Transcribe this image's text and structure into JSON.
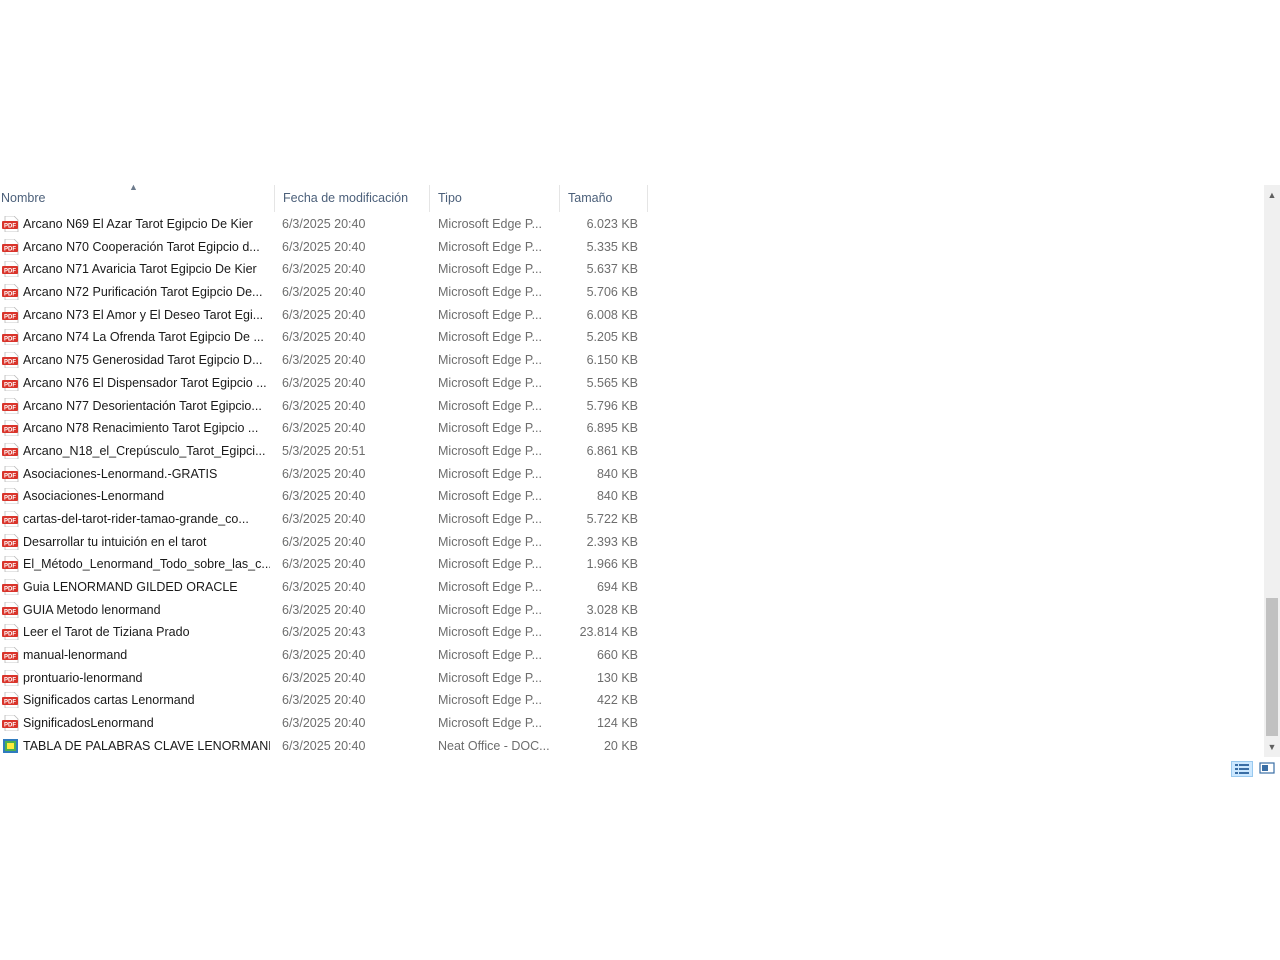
{
  "columns": {
    "name": "Nombre",
    "date": "Fecha de modificación",
    "type": "Tipo",
    "size": "Tamaño"
  },
  "sort_indicator": "^",
  "files": [
    {
      "icon": "pdf-icon",
      "name": "Arcano N69 El Azar Tarot Egipcio De Kier",
      "date": "6/3/2025 20:40",
      "type": "Microsoft Edge P...",
      "size": "6.023 KB"
    },
    {
      "icon": "pdf-icon",
      "name": "Arcano N70 Cooperación Tarot Egipcio d...",
      "date": "6/3/2025 20:40",
      "type": "Microsoft Edge P...",
      "size": "5.335 KB"
    },
    {
      "icon": "pdf-icon",
      "name": "Arcano N71 Avaricia Tarot Egipcio De Kier",
      "date": "6/3/2025 20:40",
      "type": "Microsoft Edge P...",
      "size": "5.637 KB"
    },
    {
      "icon": "pdf-icon",
      "name": "Arcano N72 Purificación Tarot Egipcio De...",
      "date": "6/3/2025 20:40",
      "type": "Microsoft Edge P...",
      "size": "5.706 KB"
    },
    {
      "icon": "pdf-icon",
      "name": "Arcano N73 El Amor y El Deseo Tarot Egi...",
      "date": "6/3/2025 20:40",
      "type": "Microsoft Edge P...",
      "size": "6.008 KB"
    },
    {
      "icon": "pdf-icon",
      "name": "Arcano N74 La Ofrenda Tarot Egipcio De ...",
      "date": "6/3/2025 20:40",
      "type": "Microsoft Edge P...",
      "size": "5.205 KB"
    },
    {
      "icon": "pdf-icon",
      "name": "Arcano N75 Generosidad Tarot Egipcio D...",
      "date": "6/3/2025 20:40",
      "type": "Microsoft Edge P...",
      "size": "6.150 KB"
    },
    {
      "icon": "pdf-icon",
      "name": "Arcano N76 El Dispensador Tarot Egipcio ...",
      "date": "6/3/2025 20:40",
      "type": "Microsoft Edge P...",
      "size": "5.565 KB"
    },
    {
      "icon": "pdf-icon",
      "name": "Arcano N77 Desorientación Tarot Egipcio...",
      "date": "6/3/2025 20:40",
      "type": "Microsoft Edge P...",
      "size": "5.796 KB"
    },
    {
      "icon": "pdf-icon",
      "name": "Arcano N78 Renacimiento Tarot Egipcio ...",
      "date": "6/3/2025 20:40",
      "type": "Microsoft Edge P...",
      "size": "6.895 KB"
    },
    {
      "icon": "pdf-icon",
      "name": "Arcano_N18_el_Crepúsculo_Tarot_Egipci...",
      "date": "5/3/2025 20:51",
      "type": "Microsoft Edge P...",
      "size": "6.861 KB"
    },
    {
      "icon": "pdf-icon",
      "name": "Asociaciones-Lenormand.-GRATIS",
      "date": "6/3/2025 20:40",
      "type": "Microsoft Edge P...",
      "size": "840 KB"
    },
    {
      "icon": "pdf-icon",
      "name": "Asociaciones-Lenormand",
      "date": "6/3/2025 20:40",
      "type": "Microsoft Edge P...",
      "size": "840 KB"
    },
    {
      "icon": "pdf-icon",
      "name": "cartas-del-tarot-rider-tamao-grande_co...",
      "date": "6/3/2025 20:40",
      "type": "Microsoft Edge P...",
      "size": "5.722 KB"
    },
    {
      "icon": "pdf-icon",
      "name": "Desarrollar tu intuición en el tarot",
      "date": "6/3/2025 20:40",
      "type": "Microsoft Edge P...",
      "size": "2.393 KB"
    },
    {
      "icon": "pdf-icon",
      "name": "El_Método_Lenormand_Todo_sobre_las_c...",
      "date": "6/3/2025 20:40",
      "type": "Microsoft Edge P...",
      "size": "1.966 KB"
    },
    {
      "icon": "pdf-icon",
      "name": "Guia LENORMAND GILDED ORACLE",
      "date": "6/3/2025 20:40",
      "type": "Microsoft Edge P...",
      "size": "694 KB"
    },
    {
      "icon": "pdf-icon",
      "name": "GUIA Metodo lenormand",
      "date": "6/3/2025 20:40",
      "type": "Microsoft Edge P...",
      "size": "3.028 KB"
    },
    {
      "icon": "pdf-icon",
      "name": "Leer el Tarot de Tiziana Prado",
      "date": "6/3/2025 20:43",
      "type": "Microsoft Edge P...",
      "size": "23.814 KB"
    },
    {
      "icon": "pdf-icon",
      "name": "manual-lenormand",
      "date": "6/3/2025 20:40",
      "type": "Microsoft Edge P...",
      "size": "660 KB"
    },
    {
      "icon": "pdf-icon",
      "name": "prontuario-lenormand",
      "date": "6/3/2025 20:40",
      "type": "Microsoft Edge P...",
      "size": "130 KB"
    },
    {
      "icon": "pdf-icon",
      "name": "Significados cartas Lenormand",
      "date": "6/3/2025 20:40",
      "type": "Microsoft Edge P...",
      "size": "422 KB"
    },
    {
      "icon": "pdf-icon",
      "name": "SignificadosLenormand",
      "date": "6/3/2025 20:40",
      "type": "Microsoft Edge P...",
      "size": "124 KB"
    },
    {
      "icon": "doc-icon",
      "name": "TABLA DE PALABRAS CLAVE LENORMAND",
      "date": "6/3/2025 20:40",
      "type": "Neat Office - DOC...",
      "size": "20 KB"
    }
  ],
  "colors": {
    "pdf_red": "#d9342b",
    "header_text": "#4c607a",
    "muted_text": "#6d6d6d",
    "selected_view": "#cce8ff"
  }
}
